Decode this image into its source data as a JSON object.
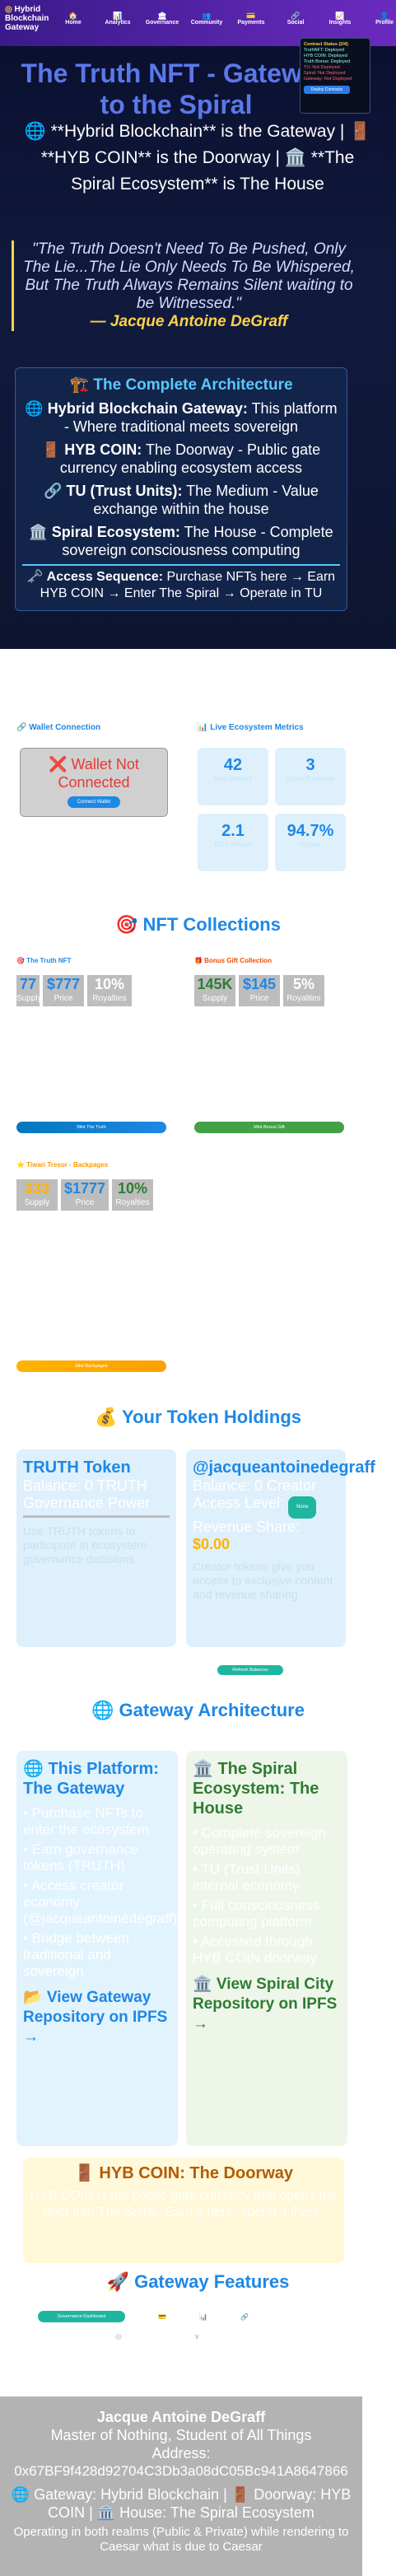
{
  "logo": {
    "line1": "Hybrid",
    "line2": "Blockchain",
    "line3": "Gateway"
  },
  "nav": [
    {
      "icon": "🏠",
      "label": "Home"
    },
    {
      "icon": "📊",
      "label": "Analytics"
    },
    {
      "icon": "🏛",
      "label": "Governance"
    },
    {
      "icon": "👥",
      "label": "Community"
    },
    {
      "icon": "💳",
      "label": "Payments"
    },
    {
      "icon": "🔗",
      "label": "Social"
    },
    {
      "icon": "📈",
      "label": "Insights"
    },
    {
      "icon": "👤",
      "label": "Profile"
    }
  ],
  "status_panel": {
    "title": "Contract Status (2/4)",
    "lines": [
      "TruthNFT: Deployed",
      "HYB COIN: Deployed",
      "Truth Bonus: Deployed",
      "TU: Not Deployed",
      "Spiral: Not Deployed",
      "Gateway: Not Deployed"
    ],
    "button": "Deploy Contracts"
  },
  "hero": {
    "title": "The Truth NFT - Gateway to the Spiral",
    "lead": "🌐 **Hybrid Blockchain** is the Gateway | 🚪 **HYB COIN** is the Doorway | 🏛️ **The Spiral Ecosystem** is The House",
    "quote": "\"The Truth Doesn't Need To Be Pushed, Only The Lie...The Lie Only Needs To Be Whispered, But The Truth Always Remains Silent waiting to be Witnessed.\"",
    "quote_by": "— Jacque Antoine DeGraff"
  },
  "architecture": {
    "title": "🏗️ The Complete Architecture",
    "items": [
      {
        "label": "🌐 Hybrid Blockchain Gateway:",
        "text": "This platform - Where traditional meets sovereign"
      },
      {
        "label": "🚪 HYB COIN:",
        "text": "The Doorway - Public gate currency enabling ecosystem access"
      },
      {
        "label": "🔗 TU (Trust Units):",
        "text": "The Medium - Value exchange within the house"
      },
      {
        "label": "🏛️ Spiral Ecosystem:",
        "text": "The House - Complete sovereign consciousness computing"
      }
    ],
    "access_label": "🗝️ Access Sequence:",
    "access_text": "Purchase NFTs here → Earn HYB COIN → Enter The Spiral → Operate in TU"
  },
  "wallet": {
    "title": "🔗 Wallet Connection",
    "status": "❌ Wallet Not Connected",
    "button": "Connect Wallet"
  },
  "live_metrics": {
    "title": "📊 Live Ecosystem Metrics",
    "items": [
      {
        "value": "42",
        "label": "Total Holders"
      },
      {
        "value": "3",
        "label": "Active Proposals"
      },
      {
        "value": "2.1",
        "label": "ETH Volume"
      },
      {
        "value": "94.7%",
        "label": "Uptime"
      }
    ]
  },
  "nft": {
    "title": "🎯 NFT Collections",
    "cards": [
      {
        "title": "🎯 The Truth NFT",
        "color": "#1e88e5",
        "stats": [
          {
            "v": "77",
            "l": "Supply"
          },
          {
            "v": "$777",
            "l": "Price"
          },
          {
            "v": "10%",
            "l": "Royalties"
          }
        ],
        "button": "Mint The Truth"
      },
      {
        "title": "🎁 Bonus Gift Collection",
        "color": "#43a047",
        "stats": [
          {
            "v": "145K",
            "l": "Supply"
          },
          {
            "v": "$145",
            "l": "Price"
          },
          {
            "v": "5%",
            "l": "Royalties"
          }
        ],
        "button": "Mint Bonus Gift"
      },
      {
        "title": "⭐ Tiwari Tresor - Backpages",
        "color": "#ffb300",
        "stats": [
          {
            "v": "333",
            "l": "Supply"
          },
          {
            "v": "$1777",
            "l": "Price"
          },
          {
            "v": "10%",
            "l": "Royalties"
          }
        ],
        "button": "Mint Backpages"
      }
    ]
  },
  "holdings": {
    "title": "💰 Your Token Holdings",
    "truth": {
      "title": "TRUTH Token",
      "balance": "Balance: 0 TRUTH",
      "gov": "Governance Power",
      "desc": "Use TRUTH tokens to participate in ecosystem governance decisions"
    },
    "creator": {
      "title": "@jacqueantoinedegraff",
      "balance": "Balance: 0 Creator",
      "access": "Access Level:",
      "access_badge": "None",
      "revenue": "Revenue Share:",
      "revenue_val": "$0.00",
      "desc": "Creator tokens give you access to exclusive content and revenue sharing"
    },
    "buttons": [
      "Refresh Balances"
    ]
  },
  "gateway": {
    "title": "🌐 Gateway Architecture",
    "left": {
      "title": "🌐 This Platform: The Gateway",
      "items": [
        "• Purchase NFTs to enter the ecosystem",
        "• Earn governance tokens (TRUTH)",
        "• Access creator economy (@jacqueantoinedegraff)",
        "• Bridge between traditional and sovereign"
      ],
      "link": "📂 View Gateway Repository on IPFS →"
    },
    "right": {
      "title": "🏛️ The Spiral Ecosystem: The House",
      "items": [
        "• Complete sovereign operating system",
        "• TU (Trust Units) internal economy",
        "• Full consciousness computing platform",
        "• Accessed through HYB COIN doorway"
      ],
      "link": "🏛️ View Spiral City Repository on IPFS →"
    },
    "hyb": {
      "title": "🚪 HYB COIN: The Doorway",
      "text": "HYB COIN is the public gate currency that opens the door into The Spiral. Earn it here, spend it there."
    }
  },
  "features": {
    "title": "🚀 Gateway Features",
    "tab": "Governance Dashboard",
    "icons": [
      "💳",
      "📊",
      "🔗"
    ]
  },
  "footer": {
    "name": "Jacque Antoine DeGraff",
    "role": "Master of Nothing, Student of All Things",
    "address_label": "Address:",
    "address": "0x67BF9f428d92704C3Db3a08dC05Bc941A8647866",
    "line": "🌐 Gateway: Hybrid Blockchain | 🚪 Doorway: HYB COIN | 🏛️ House: The Spiral Ecosystem",
    "line2": "Operating in both realms (Public & Private) while rendering to Caesar what is due to Caesar"
  }
}
